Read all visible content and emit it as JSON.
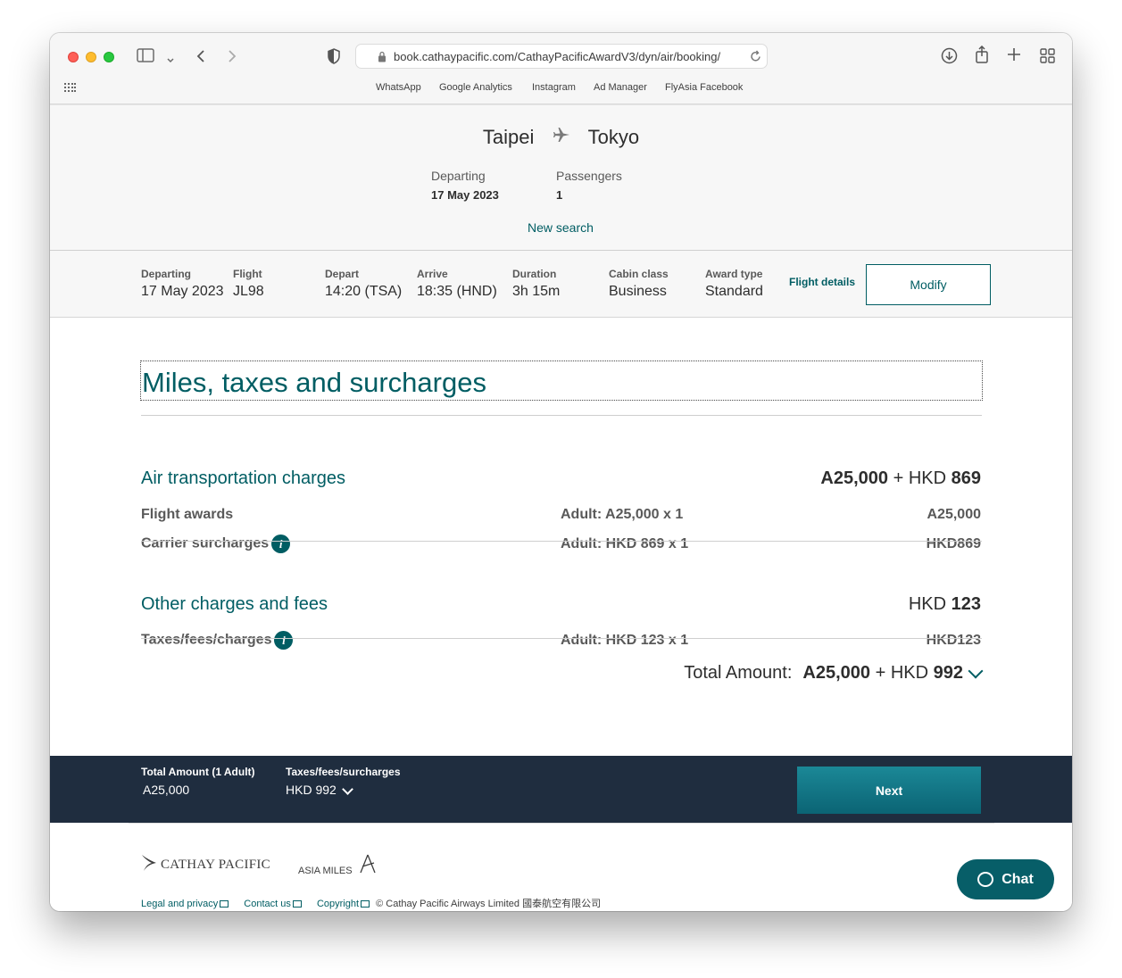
{
  "browser": {
    "url": "book.cathaypacific.com/CathayPacificAwardV3/dyn/air/booking/",
    "bookmarks": [
      "WhatsApp",
      "Google Analytics",
      "Instagram",
      "Ad Manager",
      "FlyAsia Facebook"
    ]
  },
  "hero": {
    "origin": "Taipei",
    "destination": "Tokyo",
    "departing_label": "Departing",
    "departing_value": "17 May 2023",
    "passengers_label": "Passengers",
    "passengers_value": "1",
    "new_search": "New search"
  },
  "flight_summary": {
    "departing_label": "Departing",
    "departing_value": "17 May 2023",
    "flight_label": "Flight",
    "flight_value": "JL98",
    "depart_label": "Depart",
    "depart_value": "14:20 (TSA)",
    "arrive_label": "Arrive",
    "arrive_value": "18:35 (HND)",
    "duration_label": "Duration",
    "duration_value": "3h 15m",
    "cabin_label": "Cabin class",
    "cabin_value": "Business",
    "award_label": "Award type",
    "award_value": "Standard",
    "flight_details": "Flight details",
    "modify": "Modify"
  },
  "charges": {
    "heading": "Miles, taxes and surcharges",
    "air": {
      "title": "Air transportation charges",
      "total_miles": "A25,000",
      "total_plus": "+ HKD",
      "total_hkd": "869",
      "rows": [
        {
          "label": "Flight awards",
          "detail": "Adult: A25,000 x 1",
          "amount": "A25,000"
        },
        {
          "label": "Carrier surcharges",
          "detail": "Adult: HKD 869 x 1",
          "amount": "HKD869"
        }
      ]
    },
    "other": {
      "title": "Other charges and fees",
      "total_prefix": "HKD",
      "total_hkd": "123",
      "rows": [
        {
          "label": "Taxes/fees/charges",
          "detail": "Adult: HKD 123 x 1",
          "amount": "HKD123"
        }
      ]
    },
    "total": {
      "label": "Total Amount:",
      "miles": "A25,000",
      "plus": "+ HKD",
      "hkd": "992"
    }
  },
  "bottom_bar": {
    "total_label": "Total Amount (1 Adult)",
    "total_value": "A25,000",
    "taxes_label": "Taxes/fees/surcharges",
    "taxes_value": "HKD 992",
    "next": "Next"
  },
  "footer": {
    "cathay_logo": "CATHAY PACIFIC",
    "asia_miles_logo": "ASIA MILES",
    "legal": "Legal and privacy",
    "contact": "Contact us",
    "copyright_link": "Copyright",
    "copyright_text": "© Cathay Pacific Airways Limited 國泰航空有限公司"
  },
  "chat": {
    "label": "Chat"
  },
  "colors": {
    "brand": "#005d63",
    "bar": "#1f2d3f",
    "next": "#0b6474"
  }
}
